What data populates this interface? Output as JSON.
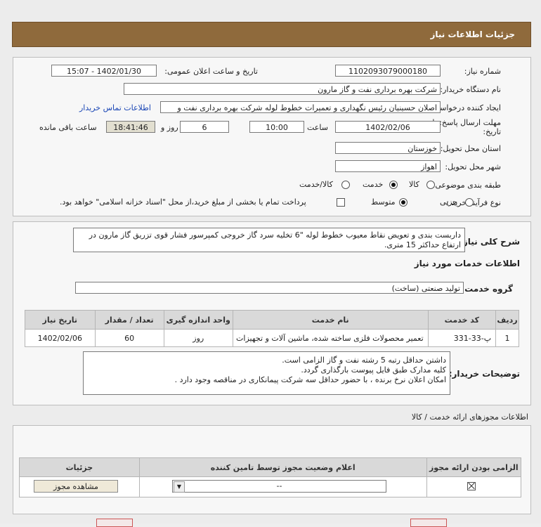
{
  "header": {
    "title": "جزئیات اطلاعات نیاز"
  },
  "form": {
    "need_number_label": "شماره نیاز:",
    "need_number": "1102093079000180",
    "announce_label": "تاریخ و ساعت اعلان عمومی:",
    "announce_value": "1402/01/30 - 15:07",
    "buyer_org_label": "نام دستگاه خریدار:",
    "buyer_org": "شرکت بهره برداری نفت و گاز مارون",
    "creator_label": "ایجاد کننده درخواست:",
    "creator": "اصلان حسینیان رئیس نگهداری و تعمیرات خطوط لوله شرکت بهره برداری نفت و",
    "contact_link": "اطلاعات تماس خریدار",
    "deadline_label_1": "مهلت ارسال پاسخ: تا",
    "deadline_label_2": "تاریخ:",
    "deadline_date": "1402/02/06",
    "time_label": "ساعت",
    "deadline_time": "10:00",
    "days_value": "6",
    "days_label": "روز و",
    "remaining_time": "18:41:46",
    "remaining_label": "ساعت باقی مانده",
    "province_label": "استان محل تحویل:",
    "province": "خوزستان",
    "city_label": "شهر محل تحویل:",
    "city": "اهواز",
    "category_label": "طبقه بندی موضوعی:",
    "category_options": [
      "کالا",
      "خدمت",
      "کالا/خدمت"
    ],
    "category_selected": "خدمت",
    "process_label": "نوع فرآیند خرید :",
    "process_options": [
      "جزیی",
      "متوسط"
    ],
    "process_selected": "متوسط",
    "treasury_note": "پرداخت تمام یا بخشی از مبلغ خرید،از محل \"اسناد خزانه اسلامی\" خواهد بود."
  },
  "need": {
    "desc_label": "شرح کلی نیاز:",
    "description": "داربست بندی و تعویض نقاط معیوب خطوط لوله \"6 تخلیه سرد گاز خروجی کمپرسور فشار قوی تزریق گاز مارون در ارتفاع حداکثر 15 متری.",
    "services_heading": "اطلاعات خدمات مورد نیاز",
    "service_group_label": "گروه خدمت:",
    "service_group": "تولید صنعتی (ساخت)",
    "table": {
      "headers": [
        "ردیف",
        "کد خدمت",
        "نام خدمت",
        "واحد اندازه گیری",
        "تعداد / مقدار",
        "تاریخ نیاز"
      ],
      "rows": [
        [
          "1",
          "پ-33-331",
          "تعمیر محصولات فلزی ساخته شده، ماشین آلات و تجهیزات",
          "روز",
          "60",
          "1402/02/06"
        ]
      ]
    },
    "buyer_notes_label": "توضیحات خریدار:",
    "buyer_notes": [
      "داشتن حداقل رتبه 5 رشته نفت و گاز الزامی است.",
      "کلیه مدارک طبق فایل پیوست بارگذاری گردد.",
      " امکان اعلان نرخ برنده ، با حضور حداقل سه شرکت پیمانکاری در مناقصه وجود دارد ."
    ]
  },
  "permits": {
    "heading": "اطلاعات مجوزهای ارائه خدمت / کالا",
    "headers": [
      "الزامی بودن ارائه مجوز",
      "اعلام وضعیت مجوز توسط تامین کننده",
      "جزئیات"
    ],
    "select_value": "--",
    "view_button": "مشاهده مجوز"
  }
}
